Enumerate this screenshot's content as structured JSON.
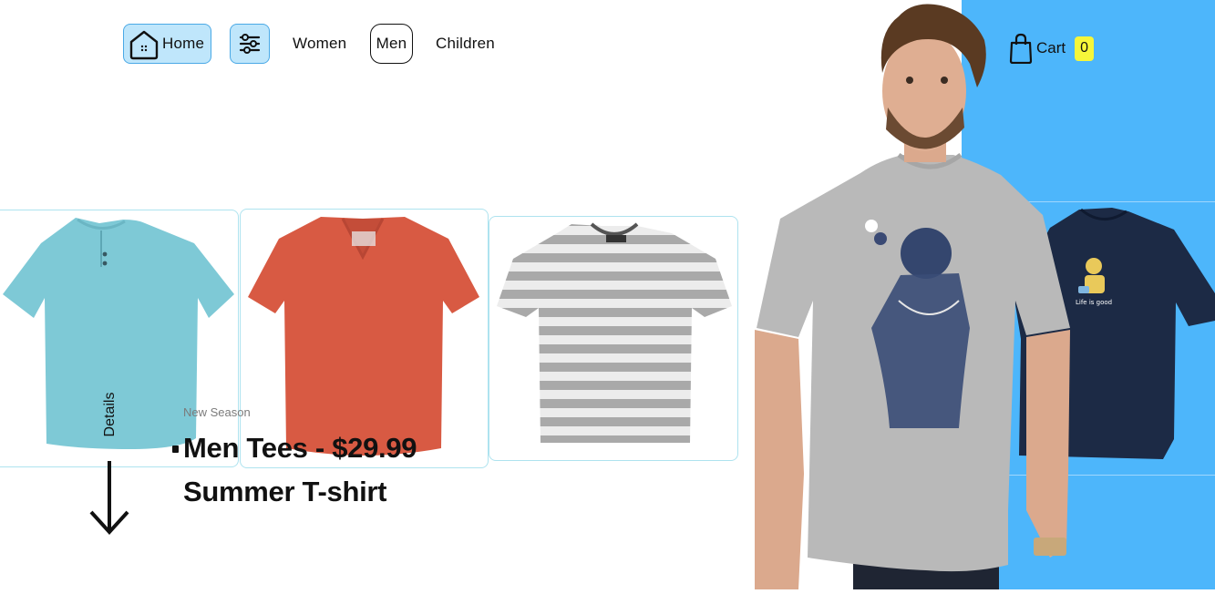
{
  "nav": {
    "home_label": "Home",
    "women_label": "Women",
    "men_label": "Men",
    "children_label": "Children",
    "home_icon": "home-icon",
    "filter_icon": "sliders-icon"
  },
  "cart": {
    "label": "Cart",
    "count": "0",
    "icon": "shopping-bag-icon"
  },
  "hero": {
    "eyebrow": "New Season",
    "title": "Men Tees - $29.99",
    "subtitle": "Summer T-shirt",
    "details_label": "Details",
    "scroll_icon": "arrow-down-icon"
  },
  "products": [
    {
      "name": "light-blue-henley-tee",
      "color": "#7ec9d6"
    },
    {
      "name": "red-vneck-tee",
      "color": "#d85a43"
    },
    {
      "name": "grey-striped-tee",
      "color": "#a9a9a9"
    }
  ],
  "colors": {
    "accent_blue": "#4db6fb",
    "nav_button_bg": "#bfe6fb",
    "cart_badge": "#f6f63a",
    "card_border": "#aee3ef"
  }
}
